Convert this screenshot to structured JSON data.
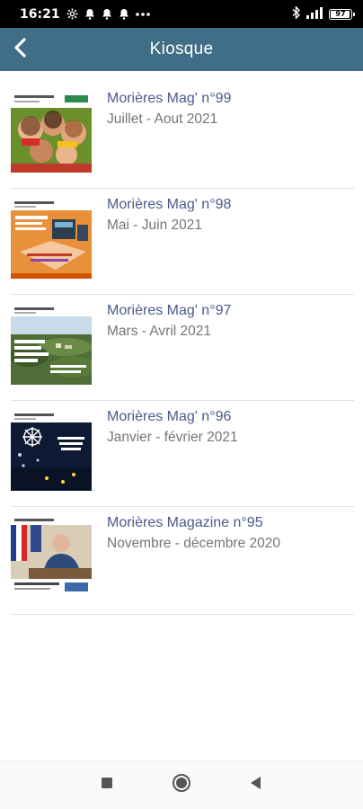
{
  "status_bar": {
    "time": "16:21",
    "battery": "97",
    "icons": [
      "settings-icon",
      "bell-icon",
      "bell-icon",
      "bell-icon",
      "more-dots-icon",
      "bluetooth-icon",
      "signal-icon",
      "battery-icon"
    ]
  },
  "app_bar": {
    "title": "Kiosque",
    "back_icon": "chevron-left-icon"
  },
  "issues": [
    {
      "title": "Morières Mag' n°99",
      "date": "Juillet - Aout 2021"
    },
    {
      "title": "Morières Mag' n°98",
      "date": "Mai - Juin 2021"
    },
    {
      "title": "Morières Mag' n°97",
      "date": "Mars - Avril 2021"
    },
    {
      "title": "Morières Mag' n°96",
      "date": "Janvier - février 2021"
    },
    {
      "title": "Morières Magazine n°95",
      "date": "Novembre - décembre 2020"
    }
  ],
  "nav_bar": {
    "icons": [
      "recents-square-icon",
      "home-circle-icon",
      "back-triangle-icon"
    ]
  },
  "colors": {
    "app_bar": "#3f6e86",
    "title_text": "#4a5a8c",
    "date_text": "#757575"
  }
}
